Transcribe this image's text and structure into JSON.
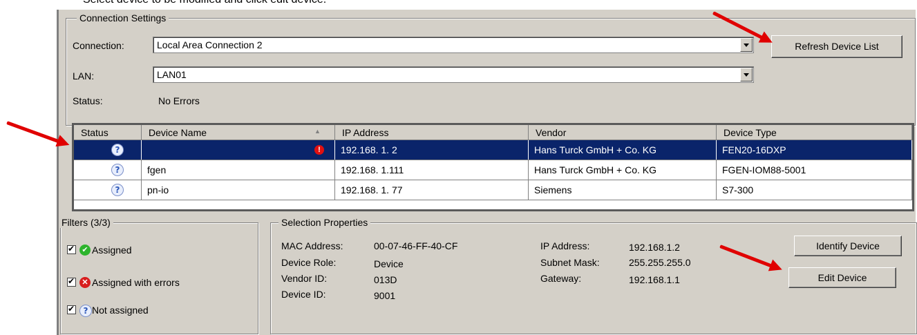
{
  "caption": "Select device to be modified and click edit device.",
  "connection_settings": {
    "title": "Connection Settings",
    "connection_label": "Connection:",
    "connection_value": "Local Area Connection 2",
    "refresh_button": "Refresh Device List",
    "lan_label": "LAN:",
    "lan_value": "LAN01",
    "status_label": "Status:",
    "status_value": "No Errors"
  },
  "table": {
    "columns": [
      "Status",
      "Device Name",
      "IP Address",
      "Vendor",
      "Device Type"
    ],
    "rows": [
      {
        "status_icon": "question-icon",
        "name": "",
        "name_flag": "!",
        "ip": "192.168.  1.  2",
        "vendor": "Hans Turck GmbH + Co. KG",
        "type": "FEN20-16DXP",
        "selected": true
      },
      {
        "status_icon": "question-icon",
        "name": "fgen",
        "name_flag": "",
        "ip": "192.168.  1.111",
        "vendor": "Hans Turck GmbH + Co. KG",
        "type": "FGEN-IOM88-5001",
        "selected": false
      },
      {
        "status_icon": "question-icon",
        "name": "pn-io",
        "name_flag": "",
        "ip": "192.168.  1. 77",
        "vendor": "Siemens",
        "type": "S7-300",
        "selected": false
      }
    ]
  },
  "filters": {
    "title": "Filters  (3/3)",
    "items": [
      {
        "label": "Assigned",
        "icon": "check-icon",
        "checked": true
      },
      {
        "label": "Assigned with errors",
        "icon": "error-icon",
        "checked": true
      },
      {
        "label": "Not assigned",
        "icon": "question-icon",
        "checked": true
      }
    ]
  },
  "selection": {
    "title": "Selection Properties",
    "mac_label": "MAC Address:",
    "mac_value": "00-07-46-FF-40-CF",
    "role_label": "Device Role:",
    "role_value": "Device",
    "vendor_label": "Vendor ID:",
    "vendor_value": "013D",
    "device_label": "Device ID:",
    "device_value": "9001",
    "ip_label": "IP Address:",
    "ip_value": "192.168.1.2",
    "subnet_label": "Subnet Mask:",
    "subnet_value": "255.255.255.0",
    "gateway_label": "Gateway:",
    "gateway_value": "192.168.1.1",
    "identify_button": "Identify Device",
    "edit_button": "Edit Device"
  },
  "colors": {
    "selection": "#0a246a",
    "arrow": "#e00000",
    "window": "#d4d0c8"
  }
}
